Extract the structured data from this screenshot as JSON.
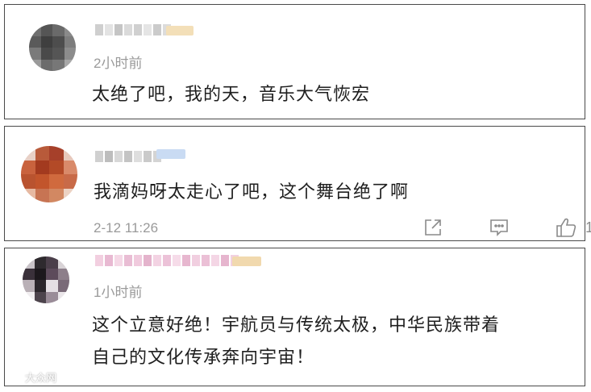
{
  "comments": [
    {
      "time": "2小时前",
      "content_lines": [
        "太绝了吧，我的天，音乐大气恢宏"
      ]
    },
    {
      "time": "2-12 11:26",
      "content_lines": [
        "我滴妈呀太走心了吧，这个舞台绝了啊"
      ],
      "actions": {
        "share_icon": "share-icon",
        "comment_icon": "comment-icon",
        "like_icon": "thumbs-up-icon",
        "like_count": "1"
      }
    },
    {
      "time": "1小时前",
      "content_lines": [
        "这个立意好绝！宇航员与传统太极，中华民族带着",
        "自己的文化传承奔向宇宙！"
      ]
    }
  ],
  "watermark": {
    "text": "大众网"
  },
  "colors": {
    "border": "#4a4a4a",
    "meta_text": "#9a9a9a",
    "content_text": "#1f1f1f",
    "action_icon": "#8a8a8a"
  }
}
